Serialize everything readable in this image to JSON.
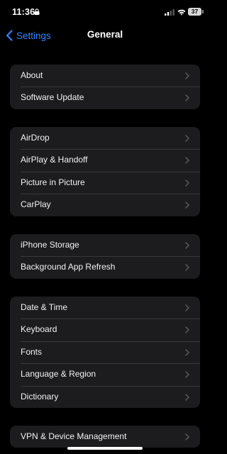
{
  "status_bar": {
    "time": "11:36",
    "battery_level": "37",
    "icons": [
      "lock-icon",
      "signal-icon",
      "wifi-icon",
      "battery-icon"
    ]
  },
  "nav": {
    "back_label": "Settings",
    "title": "General"
  },
  "colors": {
    "accent": "#2f84ff",
    "background": "#000000",
    "cell": "#1c1c1e",
    "separator": "#38383a",
    "chevron": "#5a5a5e"
  },
  "groups": [
    {
      "items": [
        {
          "label": "About"
        },
        {
          "label": "Software Update"
        }
      ]
    },
    {
      "items": [
        {
          "label": "AirDrop"
        },
        {
          "label": "AirPlay & Handoff"
        },
        {
          "label": "Picture in Picture"
        },
        {
          "label": "CarPlay"
        }
      ]
    },
    {
      "items": [
        {
          "label": "iPhone Storage"
        },
        {
          "label": "Background App Refresh"
        }
      ]
    },
    {
      "items": [
        {
          "label": "Date & Time"
        },
        {
          "label": "Keyboard"
        },
        {
          "label": "Fonts"
        },
        {
          "label": "Language & Region"
        },
        {
          "label": "Dictionary"
        }
      ]
    },
    {
      "items": [
        {
          "label": "VPN & Device Management"
        }
      ]
    }
  ]
}
